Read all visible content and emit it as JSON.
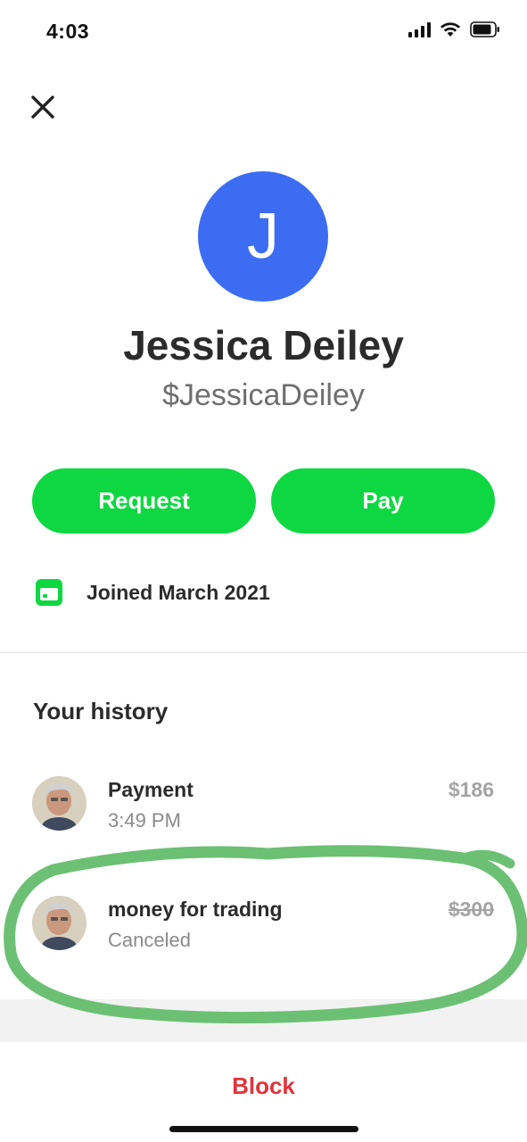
{
  "status_bar": {
    "time": "4:03"
  },
  "profile": {
    "initial": "J",
    "avatar_color": "#3b6cf2",
    "name": "Jessica Deiley",
    "cashtag": "$JessicaDeiley"
  },
  "actions": {
    "request_label": "Request",
    "pay_label": "Pay",
    "accent_color": "#0ed841"
  },
  "joined": {
    "icon": "calendar-card-icon",
    "text": "Joined March 2021"
  },
  "history": {
    "title": "Your history",
    "items": [
      {
        "title": "Payment",
        "subtitle": "3:49 PM",
        "amount": "$186",
        "canceled": false
      },
      {
        "title": "money for trading",
        "subtitle": "Canceled",
        "amount": "$300",
        "canceled": true
      }
    ]
  },
  "footer": {
    "block_label": "Block",
    "block_color": "#e2323b"
  },
  "annotation": {
    "color": "#6cc074",
    "shape": "hand-drawn circle around canceled transaction"
  }
}
